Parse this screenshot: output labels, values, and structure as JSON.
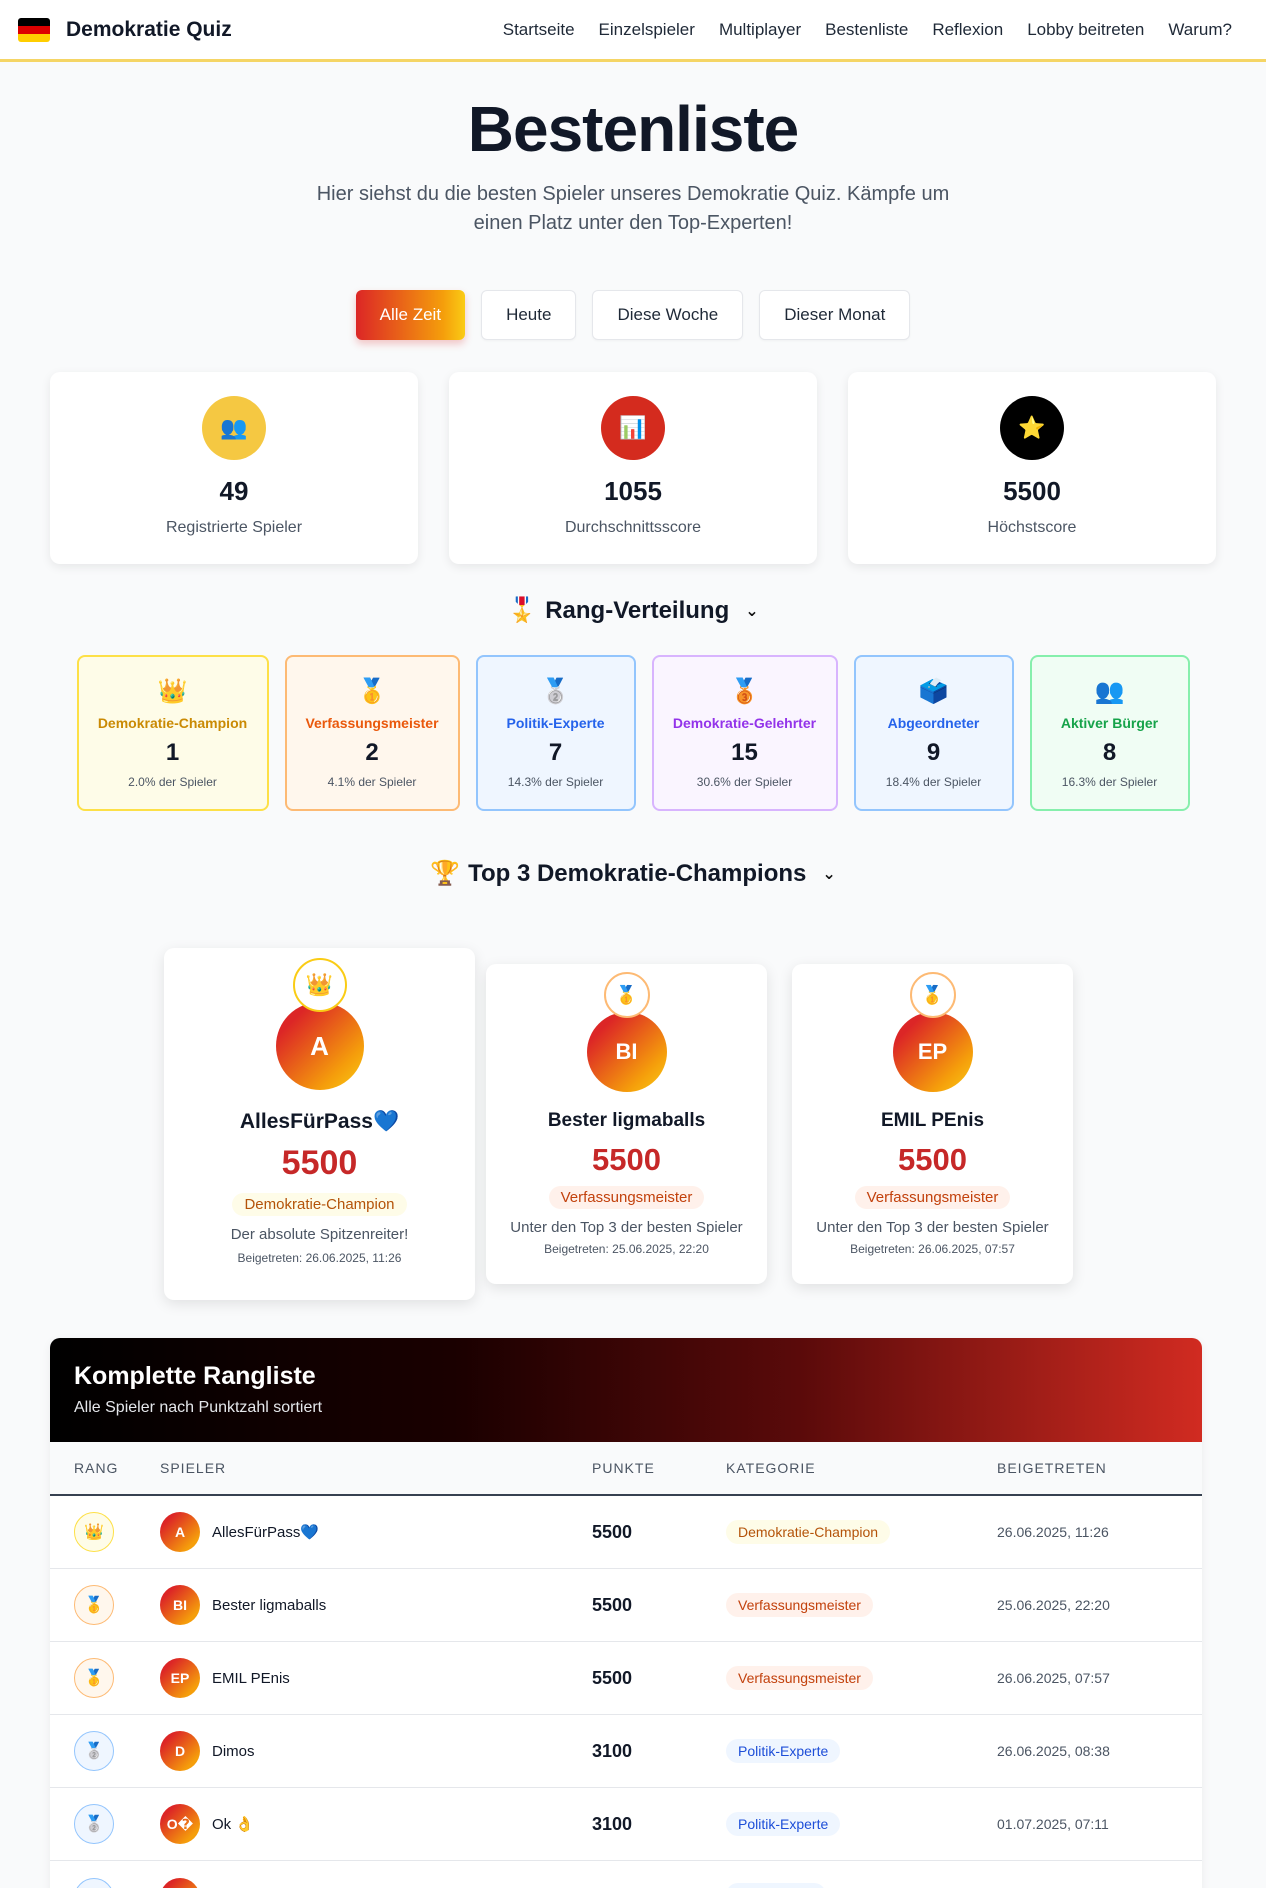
{
  "colors": {
    "accent_red": "#c62828",
    "flag": [
      "#000000",
      "#dd0000",
      "#ffce00"
    ]
  },
  "brand": {
    "title": "Demokratie Quiz"
  },
  "nav": [
    {
      "label": "Startseite"
    },
    {
      "label": "Einzelspieler"
    },
    {
      "label": "Multiplayer"
    },
    {
      "label": "Bestenliste"
    },
    {
      "label": "Reflexion"
    },
    {
      "label": "Lobby beitreten"
    },
    {
      "label": "Warum?"
    }
  ],
  "hero": {
    "title": "Bestenliste",
    "subtitle": "Hier siehst du die besten Spieler unseres Demokratie Quiz. Kämpfe um einen Platz unter den Top-Experten!"
  },
  "filters": [
    {
      "label": "Alle Zeit",
      "active": true
    },
    {
      "label": "Heute"
    },
    {
      "label": "Diese Woche"
    },
    {
      "label": "Dieser Monat"
    }
  ],
  "stats": [
    {
      "icon": "users-icon",
      "glyph": "👥",
      "value": "49",
      "label": "Registrierte Spieler"
    },
    {
      "icon": "chart-icon",
      "glyph": "📊",
      "value": "1055",
      "label": "Durchschnittsscore"
    },
    {
      "icon": "star-icon",
      "glyph": "⭐",
      "value": "5500",
      "label": "Höchstscore"
    }
  ],
  "rank_section": {
    "icon": "🎖️",
    "title": "Rang-Verteilung"
  },
  "ranks": [
    {
      "emoji": "👑",
      "name": "Demokratie-Champion",
      "count": "1",
      "pct": "2.0% der Spieler"
    },
    {
      "emoji": "🥇",
      "name": "Verfassungsmeister",
      "count": "2",
      "pct": "4.1% der Spieler"
    },
    {
      "emoji": "🥈",
      "name": "Politik-Experte",
      "count": "7",
      "pct": "14.3% der Spieler"
    },
    {
      "emoji": "🥉",
      "name": "Demokratie-Gelehrter",
      "count": "15",
      "pct": "30.6% der Spieler"
    },
    {
      "emoji": "🗳️",
      "name": "Abgeordneter",
      "count": "9",
      "pct": "18.4% der Spieler"
    },
    {
      "emoji": "👥",
      "name": "Aktiver Bürger",
      "count": "8",
      "pct": "16.3% der Spieler"
    }
  ],
  "top_section": {
    "icon": "🏆",
    "title": "Top 3 Demokratie-Champions"
  },
  "podium": [
    {
      "badge": "👑",
      "initials": "A",
      "name": "AllesFürPass💙",
      "score": "5500",
      "category": "Demokratie-Champion",
      "desc": "Der absolute Spitzenreiter!",
      "joined": "Beigetreten: 26.06.2025, 11:26"
    },
    {
      "badge": "🥇",
      "initials": "BI",
      "name": "Bester ligmaballs",
      "score": "5500",
      "category": "Verfassungsmeister",
      "desc": "Unter den Top 3 der besten Spieler",
      "joined": "Beigetreten: 25.06.2025, 22:20"
    },
    {
      "badge": "🥇",
      "initials": "EP",
      "name": "EMIL PEnis",
      "score": "5500",
      "category": "Verfassungsmeister",
      "desc": "Unter den Top 3 der besten Spieler",
      "joined": "Beigetreten: 26.06.2025, 07:57"
    }
  ],
  "table": {
    "title": "Komplette Rangliste",
    "subtitle": "Alle Spieler nach Punktzahl sortiert",
    "columns": [
      "RANG",
      "SPIELER",
      "PUNKTE",
      "KATEGORIE",
      "BEIGETRETEN"
    ],
    "rows": [
      {
        "badge": "👑",
        "initials": "A",
        "name": "AllesFürPass💙",
        "points": "5500",
        "category": "Demokratie-Champion",
        "joined": "26.06.2025, 11:26"
      },
      {
        "badge": "🥇",
        "initials": "BI",
        "name": "Bester ligmaballs",
        "points": "5500",
        "category": "Verfassungsmeister",
        "joined": "25.06.2025, 22:20"
      },
      {
        "badge": "🥇",
        "initials": "EP",
        "name": "EMIL PEnis",
        "points": "5500",
        "category": "Verfassungsmeister",
        "joined": "26.06.2025, 07:57"
      },
      {
        "badge": "🥈",
        "initials": "D",
        "name": "Dimos",
        "points": "3100",
        "category": "Politik-Experte",
        "joined": "26.06.2025, 08:38"
      },
      {
        "badge": "🥈",
        "initials": "O�",
        "name": "Ok 👌",
        "points": "3100",
        "category": "Politik-Experte",
        "joined": "01.07.2025, 07:11"
      }
    ]
  }
}
